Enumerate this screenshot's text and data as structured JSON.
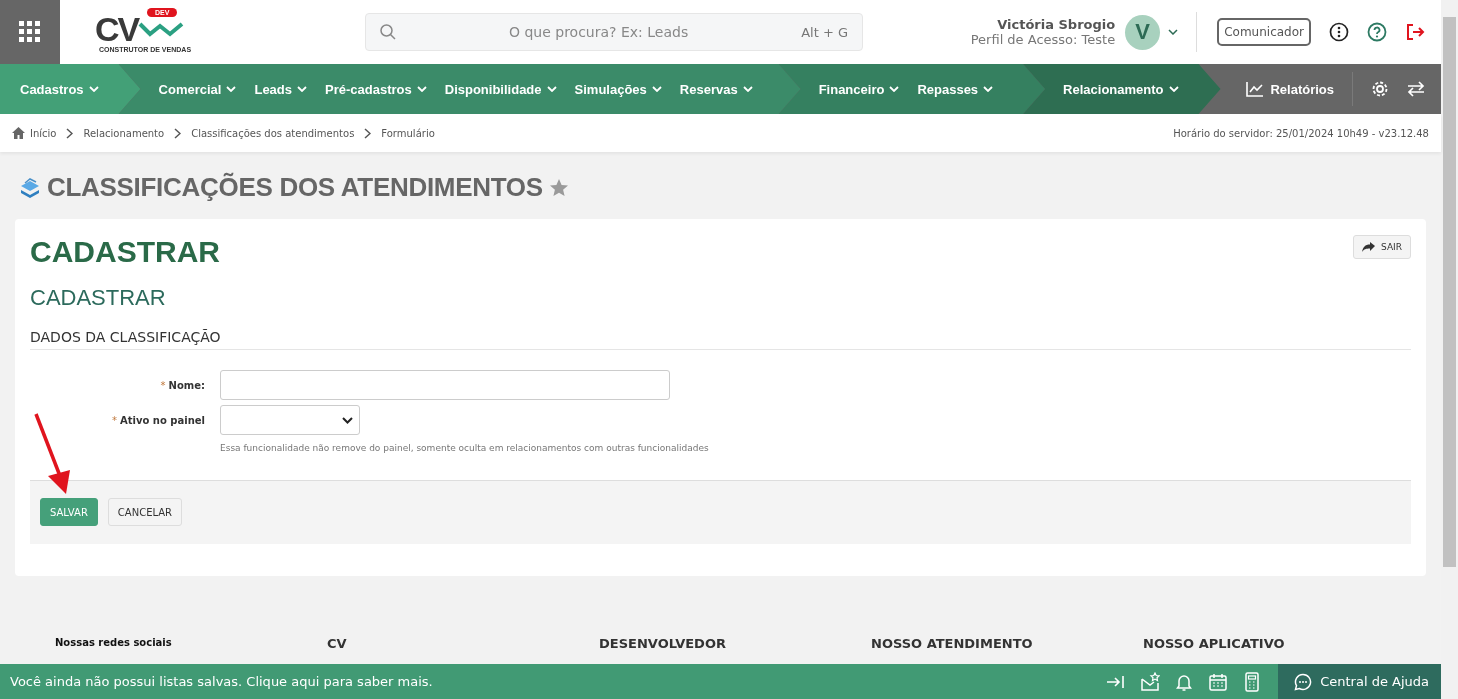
{
  "header": {
    "logo": {
      "mark": "CV",
      "badge": "DEV",
      "tagline": "CONSTRUTOR DE VENDAS"
    },
    "search": {
      "placeholder": "O que procura? Ex: Leads",
      "shortcut": "Alt + G"
    },
    "user": {
      "name": "Victória Sbrogio",
      "profile": "Perfil de Acesso: Teste",
      "initial": "V"
    },
    "communicator": "Comunicador"
  },
  "nav": {
    "groups": [
      {
        "items": [
          "Cadastros"
        ]
      },
      {
        "items": [
          "Comercial",
          "Leads",
          "Pré-cadastros",
          "Disponibilidade",
          "Simulações",
          "Reservas"
        ]
      },
      {
        "items": [
          "Financeiro",
          "Repasses"
        ]
      },
      {
        "items": [
          "Relacionamento"
        ]
      }
    ],
    "reports": "Relatórios"
  },
  "breadcrumb": [
    "Início",
    "Relacionamento",
    "Classificações dos atendimentos",
    "Formulário"
  ],
  "server_time": "Horário do servidor: 25/01/2024 10h49 - v23.12.48",
  "page_title": "CLASSIFICAÇÕES DOS ATENDIMENTOS",
  "favorite": false,
  "card": {
    "heading": "CADASTRAR",
    "subheading": "CADASTRAR",
    "section": "DADOS DA CLASSIFICAÇÃO",
    "exit": "SAIR",
    "fields": [
      {
        "kind": "text",
        "marker": "*",
        "label": "Nome:"
      },
      {
        "kind": "select",
        "marker": "*",
        "label": "Ativo no painel",
        "help": "Essa funcionalidade não remove do painel, somente oculta em relacionamentos com outras funcionalidades"
      }
    ],
    "buttons": [
      {
        "kind": "primary",
        "label": "SALVAR"
      },
      {
        "kind": "default",
        "label": "CANCELAR"
      }
    ]
  },
  "footer": {
    "social_title": "Nossas redes sociais",
    "columns": [
      "CV",
      "DESENVOLVEDOR",
      "NOSSO ATENDIMENTO",
      "NOSSO APLICATIVO"
    ]
  },
  "bottom_bar": {
    "message": "Você ainda não possui listas salvas. Clique aqui para saber mais.",
    "help": "Central de Ajuda"
  }
}
